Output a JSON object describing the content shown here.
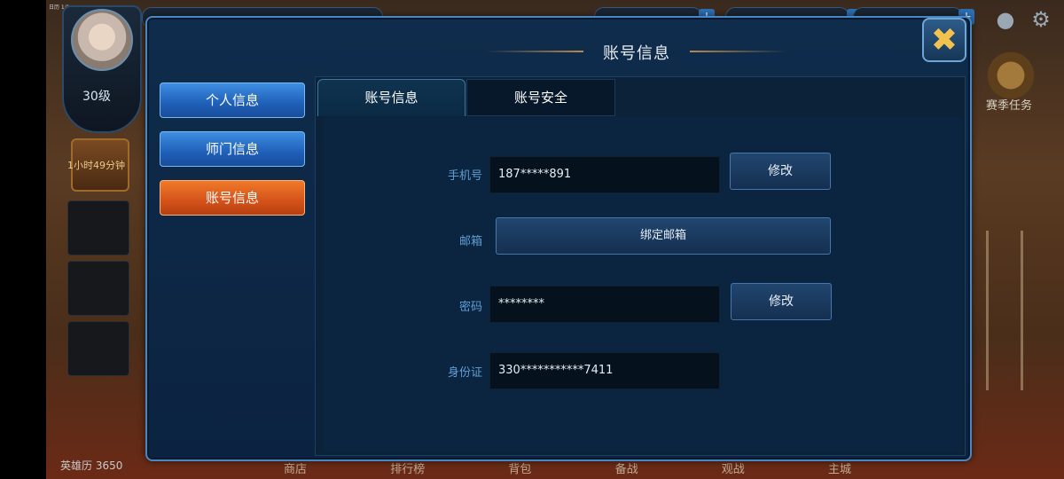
{
  "background": {
    "status_text": "日历 1/1",
    "level": "30级",
    "chest_timer": "1小时49分钟",
    "hero_history": "英雄历 3650",
    "season_task": "赛季任务",
    "bottom_menu": [
      "商店",
      "排行榜",
      "背包",
      "备战",
      "观战",
      "主城"
    ]
  },
  "panel": {
    "title": "账号信息",
    "close_icon": "close-icon"
  },
  "sidebar": {
    "items": [
      {
        "label": "个人信息",
        "active": false
      },
      {
        "label": "师门信息",
        "active": false
      },
      {
        "label": "账号信息",
        "active": true
      }
    ]
  },
  "tabs": [
    {
      "label": "账号信息",
      "active": true
    },
    {
      "label": "账号安全",
      "active": false
    }
  ],
  "form": {
    "phone": {
      "label": "手机号",
      "value": "187*****891",
      "button": "修改"
    },
    "email": {
      "label": "邮箱",
      "button": "绑定邮箱"
    },
    "password": {
      "label": "密码",
      "value": "********",
      "button": "修改"
    },
    "id_card": {
      "label": "身份证",
      "value": "330***********7411"
    }
  },
  "colors": {
    "accent_blue": "#1f5fb8",
    "accent_orange": "#d4521a",
    "label_blue": "#5e9ed3",
    "close_gold": "#f1c24e"
  }
}
